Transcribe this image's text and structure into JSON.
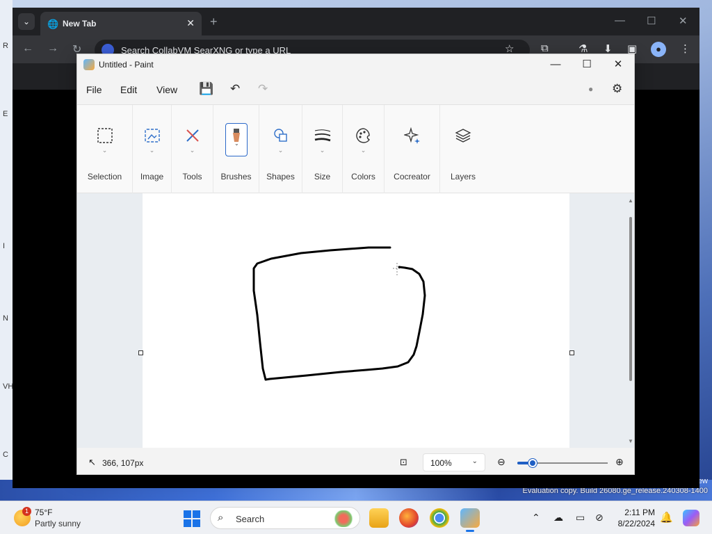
{
  "desktop": {
    "edge_chars": [
      "R",
      "E",
      "I",
      "N",
      "VH",
      "C"
    ],
    "eval_line1": "ew",
    "eval_line2": "Evaluation copy. Build 26080.ge_release.240308-1400"
  },
  "chrome": {
    "tab_title": "New Tab",
    "omnibox_placeholder": "Search CollabVM SearXNG or type a URL"
  },
  "paint": {
    "title": "Untitled - Paint",
    "menus": [
      "File",
      "Edit",
      "View"
    ],
    "ribbon": [
      {
        "label": "Selection",
        "icon": "selection-icon"
      },
      {
        "label": "Image",
        "icon": "image-icon"
      },
      {
        "label": "Tools",
        "icon": "tools-icon"
      },
      {
        "label": "Brushes",
        "icon": "brushes-icon",
        "active": true
      },
      {
        "label": "Shapes",
        "icon": "shapes-icon"
      },
      {
        "label": "Size",
        "icon": "size-icon"
      },
      {
        "label": "Colors",
        "icon": "colors-icon"
      },
      {
        "label": "Cocreator",
        "icon": "cocreator-icon"
      },
      {
        "label": "Layers",
        "icon": "layers-icon"
      }
    ],
    "status": {
      "cursor_position": "366, 107px",
      "zoom": "100%",
      "zoom_slider_fraction": 0.17
    },
    "accent_color": "#1f5fc4"
  },
  "taskbar": {
    "weather_temp": "75°F",
    "weather_desc": "Partly sunny",
    "weather_badge": "1",
    "search_placeholder": "Search",
    "time": "2:11 PM",
    "date": "8/22/2024"
  }
}
